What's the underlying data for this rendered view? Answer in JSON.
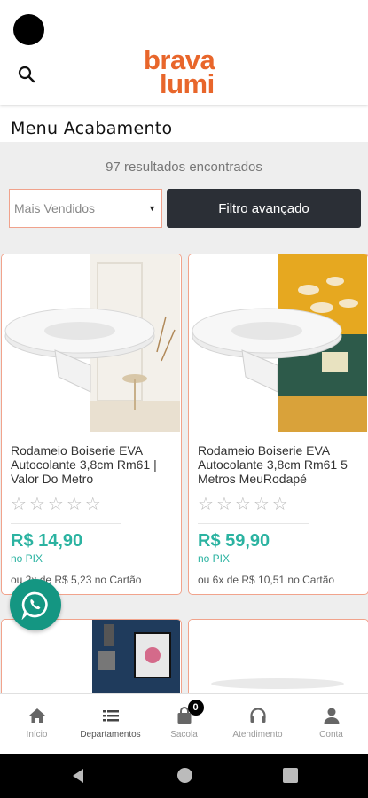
{
  "header": {
    "logo_line1": "brava",
    "logo_line2": "lumi",
    "brand_color": "#e8662b"
  },
  "page": {
    "title": "Menu Acabamento"
  },
  "filters": {
    "results_text": "97 resultados encontrados",
    "sort_selected": "Mais Vendidos",
    "advanced_filter_label": "Filtro avançado"
  },
  "products": [
    {
      "name": "Rodameio Boiserie EVA Autocolante 3,8cm Rm61 | Valor Do Metro",
      "price": "R$ 14,90",
      "pix_label": "no PIX",
      "installments": "ou 2x de R$ 5,23 no Cartão",
      "rating_stars": 0
    },
    {
      "name": "Rodameio Boiserie EVA Autocolante 3,8cm Rm61 5 Metros MeuRodapé",
      "price": "R$ 59,90",
      "pix_label": "no PIX",
      "installments": "ou 6x de R$ 10,51 no Cartão",
      "rating_stars": 0
    }
  ],
  "bottom_nav": {
    "items": [
      {
        "label": "Início",
        "icon": "home-icon"
      },
      {
        "label": "Departamentos",
        "icon": "list-icon"
      },
      {
        "label": "Sacola",
        "icon": "bag-icon",
        "badge": "0"
      },
      {
        "label": "Atendimento",
        "icon": "headset-icon"
      },
      {
        "label": "Conta",
        "icon": "user-icon"
      }
    ]
  },
  "colors": {
    "price": "#2bb3a1",
    "card_border": "#f1a38c",
    "whatsapp": "#149682",
    "dark_button": "#2b2f36"
  }
}
